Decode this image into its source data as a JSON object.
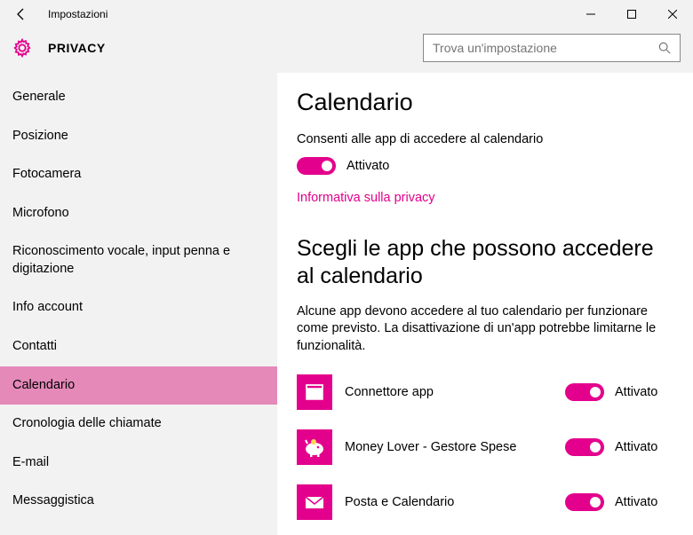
{
  "titlebar": {
    "title": "Impostazioni"
  },
  "header": {
    "title": "PRIVACY"
  },
  "search": {
    "placeholder": "Trova un'impostazione"
  },
  "sidebar": {
    "items": [
      {
        "label": "Generale"
      },
      {
        "label": "Posizione"
      },
      {
        "label": "Fotocamera"
      },
      {
        "label": "Microfono"
      },
      {
        "label": "Riconoscimento vocale, input penna e digitazione"
      },
      {
        "label": "Info account"
      },
      {
        "label": "Contatti"
      },
      {
        "label": "Calendario",
        "selected": true
      },
      {
        "label": "Cronologia delle chiamate"
      },
      {
        "label": "E-mail"
      },
      {
        "label": "Messaggistica"
      }
    ]
  },
  "content": {
    "title": "Calendario",
    "consent_label": "Consenti alle app di accedere al calendario",
    "master_toggle": {
      "state": "Attivato"
    },
    "privacy_link": "Informativa sulla privacy",
    "section_title": "Scegli le app che possono accedere al calendario",
    "section_desc": "Alcune app devono accedere al tuo calendario per funzionare come previsto. La disattivazione di un'app potrebbe limitarne le funzionalità.",
    "apps": [
      {
        "name": "Connettore app",
        "state": "Attivato",
        "icon": "window"
      },
      {
        "name": "Money Lover - Gestore Spese",
        "state": "Attivato",
        "icon": "piggy"
      },
      {
        "name": "Posta e Calendario",
        "state": "Attivato",
        "icon": "mail"
      }
    ]
  }
}
